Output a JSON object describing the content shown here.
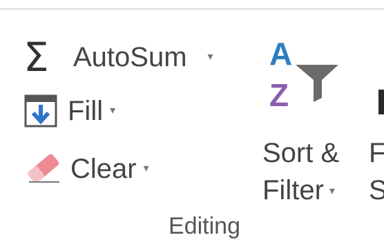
{
  "editing": {
    "autosum": {
      "label": "AutoSum",
      "icon": "sigma-icon",
      "glyph": "Σ",
      "caret": "▾"
    },
    "fill": {
      "label": "Fill",
      "icon": "fill-down-arrow-icon",
      "caret": "▾"
    },
    "clear": {
      "label": "Clear",
      "icon": "eraser-icon",
      "caret": "▾"
    },
    "sort_filter": {
      "label_line1": "Sort &",
      "label_line2": "Filter",
      "icon": "sort-az-filter-funnel-icon",
      "caret": "▾",
      "icon_letters": {
        "top": "A",
        "bottom": "Z"
      }
    },
    "find_select": {
      "label_line1": "F",
      "label_line2": "S",
      "icon": "binoculars-icon"
    },
    "group_label": "Editing"
  },
  "colors": {
    "text": "#444444",
    "letter_a": "#2e7fc0",
    "letter_z": "#8b5fb0",
    "funnel": "#666666",
    "eraser": "#e8747e",
    "fill_arrow": "#2e75c8"
  }
}
